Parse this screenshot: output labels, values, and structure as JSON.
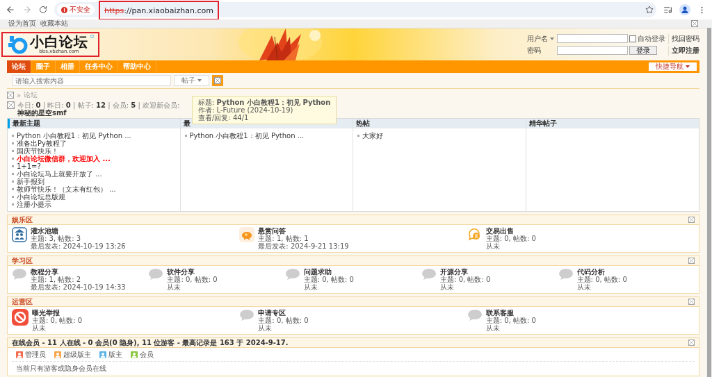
{
  "browser": {
    "security": "不安全",
    "url_scheme": "https",
    "url_rest": "://pan.xiaobaizhan.com"
  },
  "bookmarks": [
    "设为首页",
    "收藏本站"
  ],
  "logo": {
    "title": "小白论坛",
    "subtitle": "bbs.xbzhan.com"
  },
  "login": {
    "username_label": "用户名",
    "password_label": "密码",
    "remember": {
      "label": "自动登录",
      "checked": false
    },
    "login_button": "登录",
    "forgot": "找回密码",
    "register": "立即注册"
  },
  "nav": {
    "tabs": [
      {
        "label": "论坛",
        "selected": true
      },
      {
        "label": "圈子",
        "selected": false
      },
      {
        "label": "相册",
        "selected": false
      },
      {
        "label": "任务中心",
        "selected": false
      },
      {
        "label": "帮助中心",
        "selected": false
      }
    ],
    "quick_nav": "快捷导航"
  },
  "search": {
    "placeholder": "请输入搜索内容",
    "scope": "帖子"
  },
  "breadcrumb": {
    "separator": "»",
    "current": "论坛"
  },
  "stats": "今日: **0** | 昨日: **0** | 帖子: **12** | 会员: **5** | 欢迎新会员: **神秘的星空smf**",
  "tooltip": [
    "标题: **Python 小白教程1：初见 Python**",
    "作者: L-Future (2024-10-19)",
    "查看/回复: 44/1"
  ],
  "topic_columns": [
    {
      "title": "最新主题",
      "topics": [
        {
          "text": "Python 小白教程1：初见 Python ...",
          "highlight": false
        },
        {
          "text": "准备出Py教程了",
          "highlight": false
        },
        {
          "text": "国庆节快乐！",
          "highlight": false
        },
        {
          "text": "小白论坛微信群，欢迎加入 ...",
          "highlight": true
        },
        {
          "text": "1+1=?",
          "highlight": false
        },
        {
          "text": "小白论坛马上就要开放了 ...",
          "highlight": false
        },
        {
          "text": "新手报到",
          "highlight": false
        },
        {
          "text": "教师节快乐！（文末有红包） ...",
          "highlight": false
        },
        {
          "text": "小白论坛总版规",
          "highlight": false
        },
        {
          "text": "注册小提示",
          "highlight": false
        }
      ]
    },
    {
      "title": "最",
      "topics": [
        {
          "text": "Python 小白教程1：初见 Python ...",
          "highlight": false
        }
      ]
    },
    {
      "title": "热帖",
      "topics": [
        {
          "text": "大家好",
          "highlight": false
        }
      ]
    },
    {
      "title": "精华帖子"
    }
  ],
  "sections": [
    {
      "title": "娱乐区",
      "forums": [
        {
          "name": "灌水池塘",
          "kind": "group",
          "counts": "主题: 3, 帖数: 3",
          "last": "最后发表: 2024-10-19 13:26"
        },
        {
          "name": "悬赏问答",
          "kind": "piggy",
          "counts": "主题: 1, 帖数: 1",
          "last": "最后发表: 2024-9-21 13:19"
        },
        {
          "name": "交易出售",
          "kind": "coin",
          "counts": "主题: 0, 帖数: 0",
          "last": "从未"
        }
      ]
    },
    {
      "title": "学习区",
      "forums": [
        {
          "name": "教程分享",
          "kind": "bubble",
          "counts": "主题: 1, 帖数: 2",
          "last": "最后发表: 2024-10-19 14:33"
        },
        {
          "name": "软件分享",
          "kind": "bubble",
          "counts": "主题: 0, 帖数: 0",
          "last": "从未"
        },
        {
          "name": "问题求助",
          "kind": "bubble",
          "counts": "主题: 0, 帖数: 0",
          "last": "从未"
        },
        {
          "name": "开源分享",
          "kind": "bubble",
          "counts": "主题: 0, 帖数: 0",
          "last": "从未"
        },
        {
          "name": "代码分析",
          "kind": "bubble",
          "counts": "主题: 0, 帖数: 0",
          "last": "从未"
        }
      ]
    },
    {
      "title": "运营区",
      "forums": [
        {
          "name": "曝光举报",
          "kind": "forbidden",
          "counts": "主题: 0, 帖数: 0",
          "last": "从未"
        },
        {
          "name": "申请专区",
          "kind": "bubble",
          "counts": "主题: 0, 帖数: 0",
          "last": "从未"
        },
        {
          "name": "联系客服",
          "kind": "bubble",
          "counts": "主题: 0, 帖数: 0",
          "last": "从未"
        }
      ]
    }
  ],
  "online": {
    "title": "在线会员 - 11 人在线 - 0 会员(0 隐身), 11 位游客 - 最高记录是 163 于 2024-9-17.",
    "legend": [
      {
        "label": "管理员",
        "color": "#f26c4f"
      },
      {
        "label": "超级版主",
        "color": "#f5a54a"
      },
      {
        "label": "版主",
        "color": "#5ab4e8"
      },
      {
        "label": "会员",
        "color": "#8cc63f"
      }
    ],
    "note": "当前只有游客或隐身会员在线"
  }
}
